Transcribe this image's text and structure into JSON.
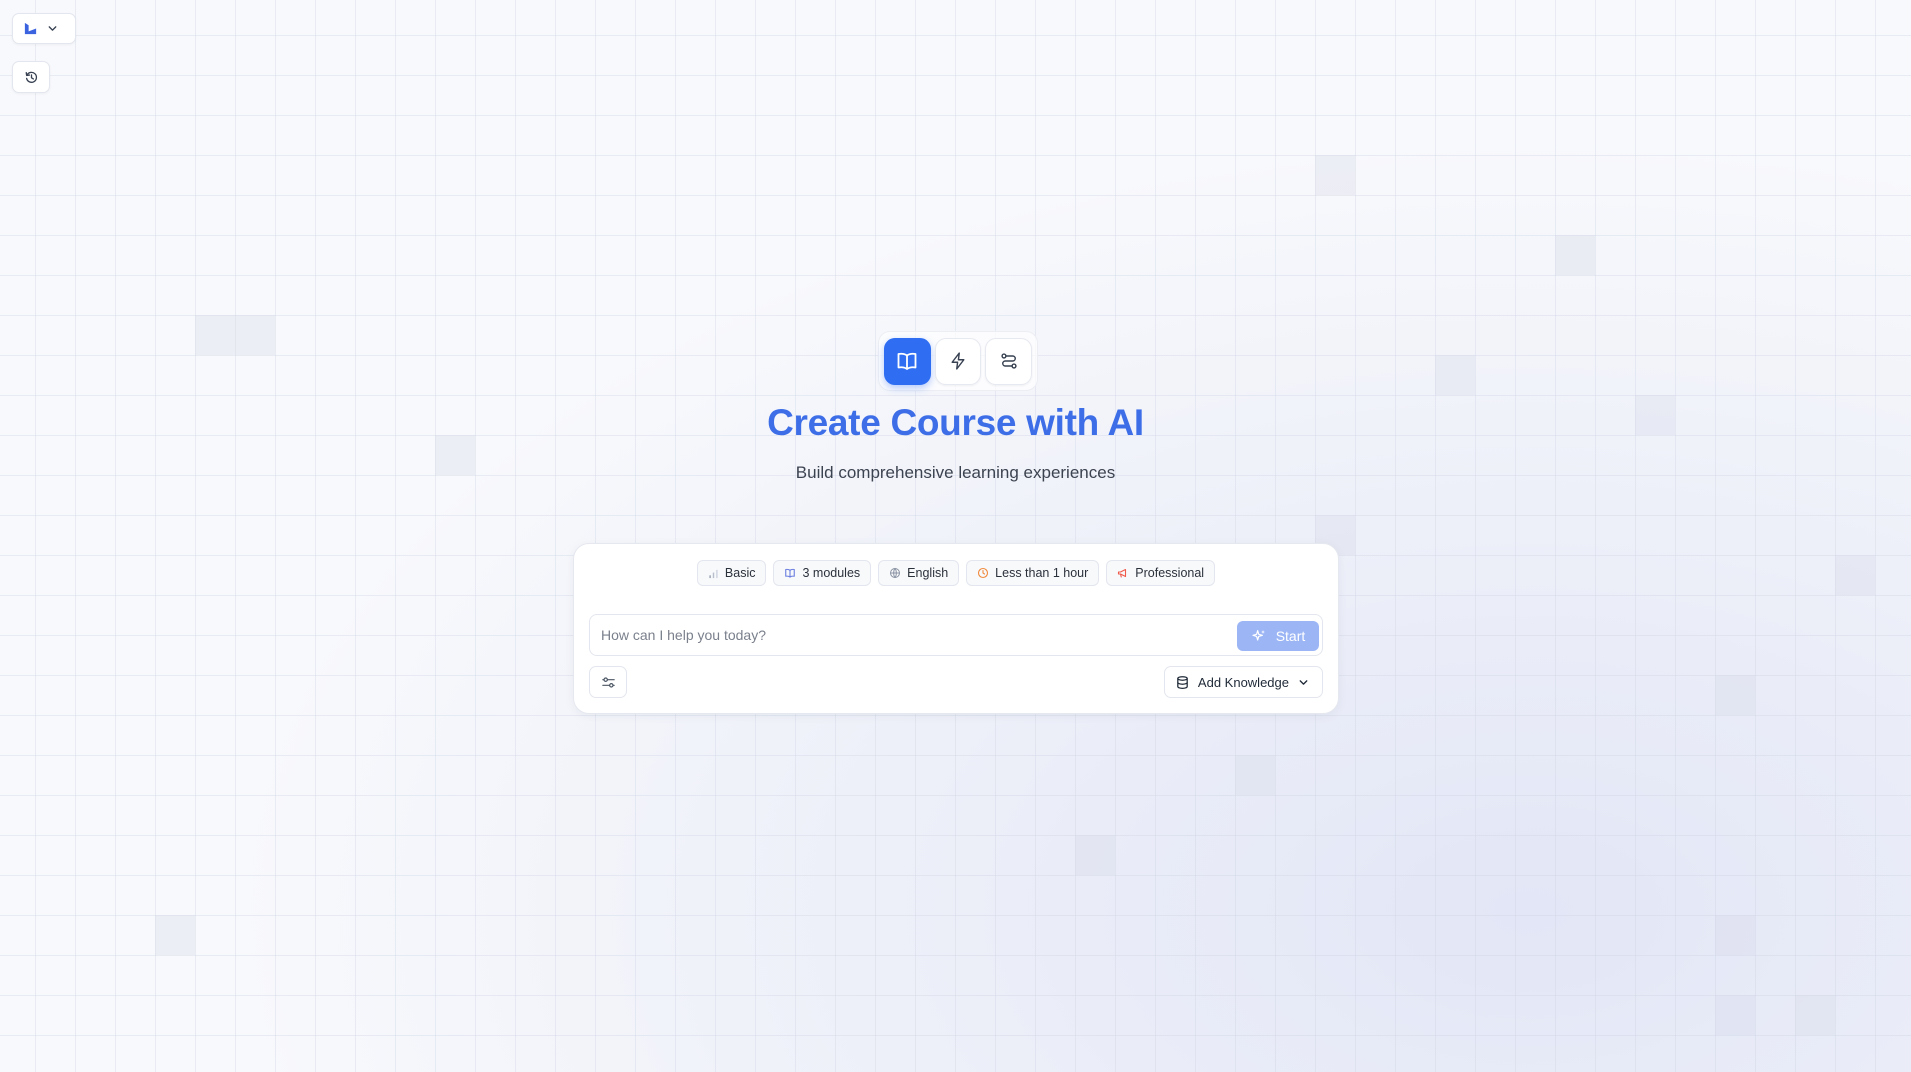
{
  "workspace": {
    "logo_icon": "brand-logo-icon",
    "menu_icon": "chevron-down-icon"
  },
  "history": {
    "icon": "history-icon"
  },
  "modes": [
    {
      "name": "course",
      "icon": "book-open-icon",
      "active": true
    },
    {
      "name": "quick",
      "icon": "lightning-icon",
      "active": false
    },
    {
      "name": "workflow",
      "icon": "route-icon",
      "active": false
    }
  ],
  "hero": {
    "title": "Create Course with AI",
    "subtitle": "Build comprehensive learning experiences"
  },
  "composer": {
    "chips": [
      {
        "label": "Basic",
        "icon": "bar-chart-icon",
        "color": "#9aa3b2"
      },
      {
        "label": "3 modules",
        "icon": "book-icon",
        "color": "#6b7ee0"
      },
      {
        "label": "English",
        "icon": "globe-icon",
        "color": "#8a93a3"
      },
      {
        "label": "Less than 1 hour",
        "icon": "clock-icon",
        "color": "#f08a3c"
      },
      {
        "label": "Professional",
        "icon": "megaphone-icon",
        "color": "#ef5a4a"
      }
    ],
    "placeholder": "How can I help you today?",
    "value": "",
    "start_label": "Start",
    "knowledge_label": "Add Knowledge"
  },
  "colors": {
    "accent": "#2f6ef3",
    "title": "#3d6ee8",
    "start_disabled": "#9bb5f5"
  }
}
